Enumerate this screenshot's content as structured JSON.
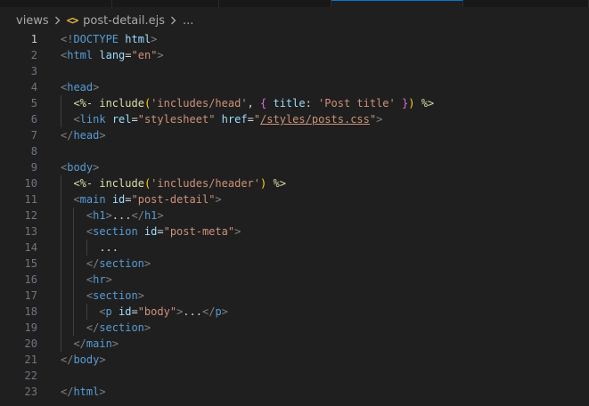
{
  "breadcrumb": {
    "folder": "views",
    "file_icon": "<>",
    "file": "post-detail.ejs",
    "more": "..."
  },
  "editor": {
    "current_line": 1,
    "lines": [
      {
        "n": "1",
        "indent": 0,
        "tokens": [
          [
            "punct",
            "<!"
          ],
          [
            "tag",
            "DOCTYPE"
          ],
          [
            "text",
            " "
          ],
          [
            "attr",
            "html"
          ],
          [
            "punct",
            ">"
          ]
        ]
      },
      {
        "n": "2",
        "indent": 0,
        "tokens": [
          [
            "punct",
            "<"
          ],
          [
            "tag",
            "html"
          ],
          [
            "text",
            " "
          ],
          [
            "attr",
            "lang"
          ],
          [
            "text",
            "="
          ],
          [
            "str",
            "\"en\""
          ],
          [
            "punct",
            ">"
          ]
        ]
      },
      {
        "n": "3",
        "indent": 0,
        "tokens": []
      },
      {
        "n": "4",
        "indent": 0,
        "tokens": [
          [
            "punct",
            "<"
          ],
          [
            "tag",
            "head"
          ],
          [
            "punct",
            ">"
          ]
        ]
      },
      {
        "n": "5",
        "indent": 1,
        "tokens": [
          [
            "ejs",
            "<%-"
          ],
          [
            "text",
            " "
          ],
          [
            "ejs",
            "include"
          ],
          [
            "paren",
            "("
          ],
          [
            "str",
            "'includes/head'"
          ],
          [
            "text",
            ", "
          ],
          [
            "brace",
            "{"
          ],
          [
            "text",
            " "
          ],
          [
            "key",
            "title"
          ],
          [
            "text",
            ": "
          ],
          [
            "str",
            "'Post title'"
          ],
          [
            "text",
            " "
          ],
          [
            "brace",
            "}"
          ],
          [
            "paren",
            ")"
          ],
          [
            "text",
            " "
          ],
          [
            "ejs",
            "%>"
          ]
        ]
      },
      {
        "n": "6",
        "indent": 1,
        "tokens": [
          [
            "punct",
            "<"
          ],
          [
            "tag",
            "link"
          ],
          [
            "text",
            " "
          ],
          [
            "attr",
            "rel"
          ],
          [
            "text",
            "="
          ],
          [
            "str",
            "\"stylesheet\""
          ],
          [
            "text",
            " "
          ],
          [
            "attr",
            "href"
          ],
          [
            "text",
            "="
          ],
          [
            "str",
            "\""
          ],
          [
            "link",
            "/styles/posts.css"
          ],
          [
            "str",
            "\""
          ],
          [
            "punct",
            ">"
          ]
        ]
      },
      {
        "n": "7",
        "indent": 0,
        "tokens": [
          [
            "punct",
            "</"
          ],
          [
            "tag",
            "head"
          ],
          [
            "punct",
            ">"
          ]
        ]
      },
      {
        "n": "8",
        "indent": 0,
        "tokens": []
      },
      {
        "n": "9",
        "indent": 0,
        "tokens": [
          [
            "punct",
            "<"
          ],
          [
            "tag",
            "body"
          ],
          [
            "punct",
            ">"
          ]
        ]
      },
      {
        "n": "10",
        "indent": 1,
        "tokens": [
          [
            "ejs",
            "<%-"
          ],
          [
            "text",
            " "
          ],
          [
            "ejs",
            "include"
          ],
          [
            "paren",
            "("
          ],
          [
            "str",
            "'includes/header'"
          ],
          [
            "paren",
            ")"
          ],
          [
            "text",
            " "
          ],
          [
            "ejs",
            "%>"
          ]
        ]
      },
      {
        "n": "11",
        "indent": 1,
        "tokens": [
          [
            "punct",
            "<"
          ],
          [
            "tag",
            "main"
          ],
          [
            "text",
            " "
          ],
          [
            "attr",
            "id"
          ],
          [
            "text",
            "="
          ],
          [
            "str",
            "\"post-detail\""
          ],
          [
            "punct",
            ">"
          ]
        ]
      },
      {
        "n": "12",
        "indent": 2,
        "tokens": [
          [
            "punct",
            "<"
          ],
          [
            "tag",
            "h1"
          ],
          [
            "punct",
            ">"
          ],
          [
            "text",
            "..."
          ],
          [
            "punct",
            "</"
          ],
          [
            "tag",
            "h1"
          ],
          [
            "punct",
            ">"
          ]
        ]
      },
      {
        "n": "13",
        "indent": 2,
        "tokens": [
          [
            "punct",
            "<"
          ],
          [
            "tag",
            "section"
          ],
          [
            "text",
            " "
          ],
          [
            "attr",
            "id"
          ],
          [
            "text",
            "="
          ],
          [
            "str",
            "\"post-meta\""
          ],
          [
            "punct",
            ">"
          ]
        ]
      },
      {
        "n": "14",
        "indent": 3,
        "tokens": [
          [
            "text",
            "..."
          ]
        ]
      },
      {
        "n": "15",
        "indent": 2,
        "tokens": [
          [
            "punct",
            "</"
          ],
          [
            "tag",
            "section"
          ],
          [
            "punct",
            ">"
          ]
        ]
      },
      {
        "n": "16",
        "indent": 2,
        "tokens": [
          [
            "punct",
            "<"
          ],
          [
            "tag",
            "hr"
          ],
          [
            "punct",
            ">"
          ]
        ]
      },
      {
        "n": "17",
        "indent": 2,
        "tokens": [
          [
            "punct",
            "<"
          ],
          [
            "tag",
            "section"
          ],
          [
            "punct",
            ">"
          ]
        ]
      },
      {
        "n": "18",
        "indent": 3,
        "tokens": [
          [
            "punct",
            "<"
          ],
          [
            "tag",
            "p"
          ],
          [
            "text",
            " "
          ],
          [
            "attr",
            "id"
          ],
          [
            "text",
            "="
          ],
          [
            "str",
            "\"body\""
          ],
          [
            "punct",
            ">"
          ],
          [
            "text",
            "..."
          ],
          [
            "punct",
            "</"
          ],
          [
            "tag",
            "p"
          ],
          [
            "punct",
            ">"
          ]
        ]
      },
      {
        "n": "19",
        "indent": 2,
        "tokens": [
          [
            "punct",
            "</"
          ],
          [
            "tag",
            "section"
          ],
          [
            "punct",
            ">"
          ]
        ]
      },
      {
        "n": "20",
        "indent": 1,
        "tokens": [
          [
            "punct",
            "</"
          ],
          [
            "tag",
            "main"
          ],
          [
            "punct",
            ">"
          ]
        ]
      },
      {
        "n": "21",
        "indent": 0,
        "tokens": [
          [
            "punct",
            "</"
          ],
          [
            "tag",
            "body"
          ],
          [
            "punct",
            ">"
          ]
        ]
      },
      {
        "n": "22",
        "indent": 0,
        "tokens": []
      },
      {
        "n": "23",
        "indent": 0,
        "tokens": [
          [
            "punct",
            "</"
          ],
          [
            "tag",
            "html"
          ],
          [
            "punct",
            ">"
          ]
        ]
      }
    ]
  }
}
